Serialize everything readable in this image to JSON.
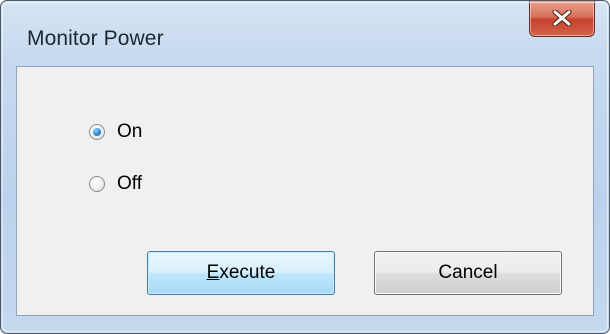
{
  "window": {
    "title": "Monitor Power",
    "close_icon": "close-icon"
  },
  "options": [
    {
      "label": "On",
      "checked": true
    },
    {
      "label": "Off",
      "checked": false
    }
  ],
  "buttons": {
    "execute": {
      "mnemonic": "E",
      "rest": "xecute"
    },
    "cancel": {
      "label": "Cancel"
    }
  },
  "colors": {
    "execute_border": "#3c7fb1",
    "close_button": "#c5432b",
    "radio_selected": "#2b8ad9"
  }
}
